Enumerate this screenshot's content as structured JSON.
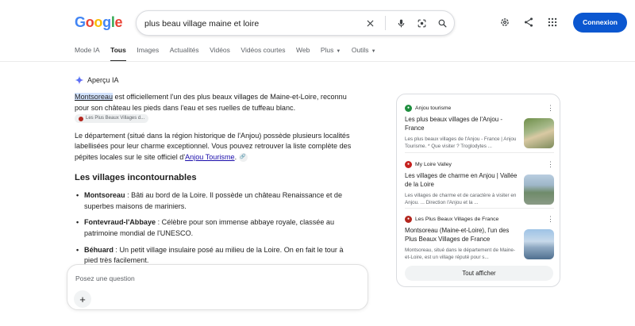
{
  "logo": {
    "letters": [
      "G",
      "o",
      "o",
      "g",
      "l",
      "e"
    ]
  },
  "search": {
    "value": "plus beau village maine et loire"
  },
  "header": {
    "connexion_label": "Connexion"
  },
  "tabs": [
    "Mode IA",
    "Tous",
    "Images",
    "Actualités",
    "Vidéos",
    "Vidéos courtes",
    "Web",
    "Plus",
    "Outils"
  ],
  "ai": {
    "title": "Aperçu IA",
    "p1_link": "Montsoreau",
    "p1_text": " est officiellement l'un des plus beaux villages de Maine-et-Loire, reconnu pour son château les pieds dans l'eau et ses ruelles de tuffeau blanc.",
    "p1_chip": "Les Plus Beaux Villages d...",
    "p2_text": "Le département (situé dans la région historique de l'Anjou) possède plusieurs localités labellisées pour leur charme exceptionnel. Vous pouvez retrouver la liste complète des pépites locales sur le site officiel d'",
    "p2_link": "Anjou Tourisme",
    "p2_end": ".",
    "heading": "Les villages incontournables",
    "items": [
      {
        "name": "Montsoreau",
        "text": " : Bâti au bord de la Loire. Il possède un château Renaissance et de superbes maisons de mariniers."
      },
      {
        "name": "Fontevraud-l'Abbaye",
        "text": " : Célèbre pour son immense abbaye royale, classée au patrimoine mondial de l'UNESCO."
      },
      {
        "name": "Béhuard",
        "text": " : Un petit village insulaire posé au milieu de la Loire. On en fait le tour à pied très facilement."
      }
    ]
  },
  "ask": {
    "placeholder": "Posez une question"
  },
  "sources": [
    {
      "site": "Anjou tourisme",
      "title": "Les plus beaux villages de l'Anjou - France",
      "snippet": "Les plus beaux villages de l'Anjou - France | Anjou Tourisme. * Que visiter ? Troglodytes ..."
    },
    {
      "site": "My Loire Valley",
      "title": "Les villages de charme en Anjou | Vallée de la Loire",
      "snippet": "Les villages de charme et de caractère à visiter en Anjou. ... Direction l'Anjou et la ..."
    },
    {
      "site": "Les Plus Beaux Villages de France",
      "title": "Montsoreau (Maine-et-Loire), l'un des Plus Beaux Villages de France",
      "snippet": "Montsoreau, situé dans le département de Maine-et-Loire, est un village réputé pour s..."
    }
  ],
  "sources_button": "Tout afficher",
  "colors": {
    "accent": "#0b57d0",
    "link": "#1a0dab",
    "highlight": "#d3e3fd"
  }
}
